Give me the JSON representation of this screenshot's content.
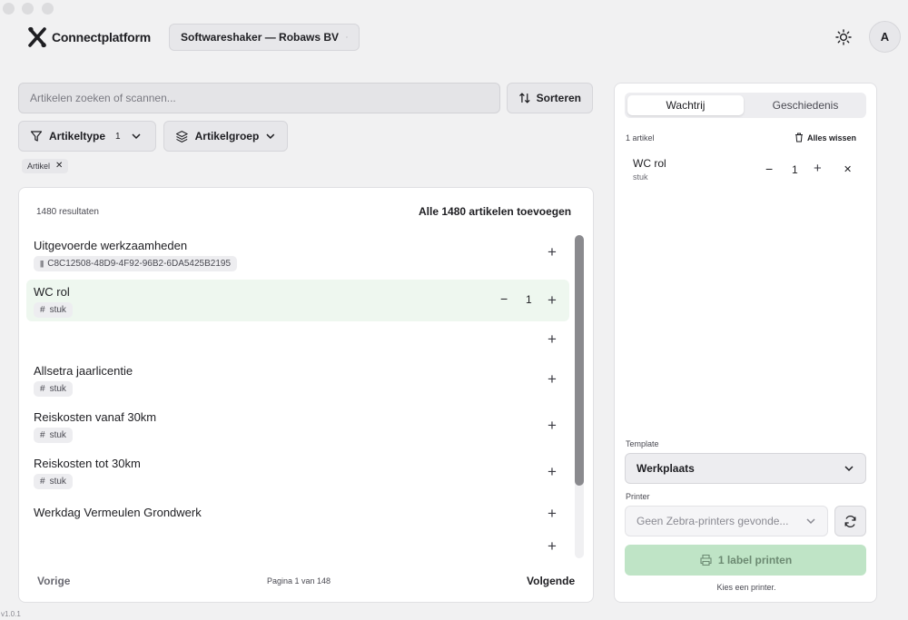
{
  "app": {
    "name": "Connectplatform",
    "version": "v1.0.1"
  },
  "header": {
    "org_selector": "Softwareshaker — Robaws BV",
    "avatar": "A"
  },
  "search": {
    "placeholder": "Artikelen zoeken of scannen...",
    "sort_label": "Sorteren"
  },
  "filters": {
    "type_label": "Artikeltype",
    "type_count": "1",
    "group_label": "Artikelgroep",
    "active_chip": "Artikel"
  },
  "results": {
    "count_label": "1480 resultaten",
    "add_all_label": "Alle 1480 artikelen toevoegen",
    "items": [
      {
        "name": "Uitgevoerde werkzaamheden",
        "tag": "C8C12508-48D9-4F92-96B2-6DA5425B2195"
      },
      {
        "name": "WC rol",
        "tag": "stuk",
        "qty": "1"
      },
      {
        "name": "",
        "tag": ""
      },
      {
        "name": "Allsetra jaarlicentie",
        "tag": "stuk"
      },
      {
        "name": "Reiskosten vanaf 30km",
        "tag": "stuk"
      },
      {
        "name": "Reiskosten tot 30km",
        "tag": "stuk"
      },
      {
        "name": "Werkdag Vermeulen Grondwerk",
        "tag": ""
      },
      {
        "name": "",
        "tag": ""
      }
    ],
    "pagination": {
      "prev": "Vorige",
      "page_info": "Pagina 1 van 148",
      "next": "Volgende"
    }
  },
  "queue": {
    "tabs": [
      "Wachtrij",
      "Geschiedenis"
    ],
    "count_label": "1 artikel",
    "clear_label": "Alles wissen",
    "items": [
      {
        "name": "WC rol",
        "unit": "stuk",
        "qty": "1"
      }
    ],
    "template_label": "Template",
    "template_value": "Werkplaats",
    "printer_label": "Printer",
    "printer_placeholder": "Geen Zebra-printers gevonde...",
    "print_button": "1 label printen",
    "hint": "Kies een printer."
  },
  "colors": {
    "highlight_row": "#eef7ef",
    "print_button_bg": "#bfe4c6",
    "accent": "#1e1e22"
  }
}
